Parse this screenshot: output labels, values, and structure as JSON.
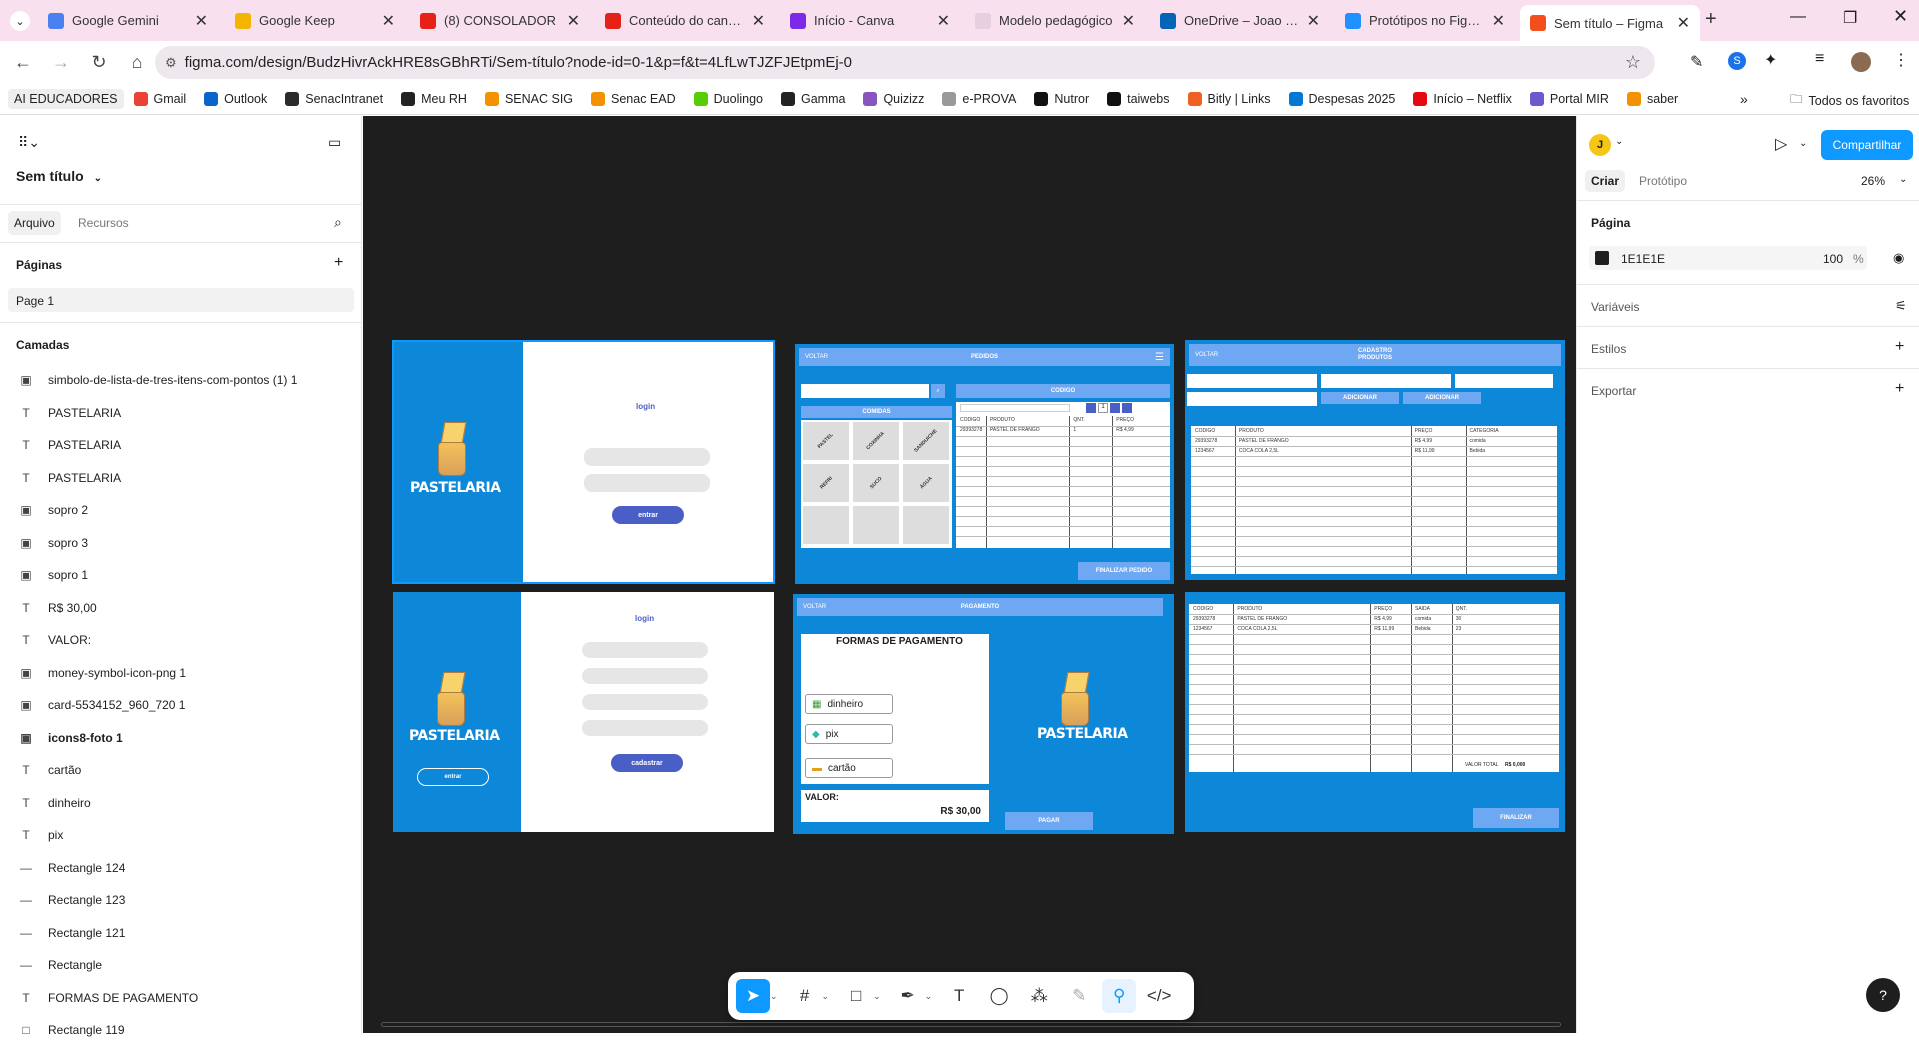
{
  "browser": {
    "tabs": [
      {
        "title": "Google Gemini",
        "color": "#4a80f0"
      },
      {
        "title": "Google Keep",
        "color": "#f5b400"
      },
      {
        "title": "(8) CONSOLADOR",
        "color": "#e62117"
      },
      {
        "title": "Conteúdo do canal -",
        "color": "#e62117"
      },
      {
        "title": "Início - Canva",
        "color": "#7d2ae8"
      },
      {
        "title": "Modelo pedagógico",
        "color": "#e8cfe0"
      },
      {
        "title": "OneDrive – Joao Beji",
        "color": "#0364b8"
      },
      {
        "title": "Protótipos no Figma",
        "color": "#1e90ff"
      },
      {
        "title": "Sem título – Figma",
        "color": "#f24e1e"
      }
    ],
    "url": "figma.com/design/BudzHivrAckHRE8sGBhRTi/Sem-título?node-id=0-1&p=f&t=4LfLwTJZFJEtpmEj-0",
    "bookmarks": [
      {
        "label": "AI EDUCADORES",
        "color": "#eee"
      },
      {
        "label": "Gmail",
        "color": "#ea4335"
      },
      {
        "label": "Outlook",
        "color": "#0a64c9"
      },
      {
        "label": "SenacIntranet",
        "color": "#2b2b2b"
      },
      {
        "label": "Meu RH",
        "color": "#222"
      },
      {
        "label": "SENAC SIG",
        "color": "#f39200"
      },
      {
        "label": "Senac EAD",
        "color": "#f39200"
      },
      {
        "label": "Duolingo",
        "color": "#58cc02"
      },
      {
        "label": "Gamma",
        "color": "#222"
      },
      {
        "label": "Quizizz",
        "color": "#8854c0"
      },
      {
        "label": "e-PROVA",
        "color": "#999"
      },
      {
        "label": "Nutror",
        "color": "#111"
      },
      {
        "label": "taiwebs",
        "color": "#111"
      },
      {
        "label": "Bitly | Links",
        "color": "#ee6123"
      },
      {
        "label": "Despesas 2025",
        "color": "#0078d4"
      },
      {
        "label": "Início – Netflix",
        "color": "#e50914"
      },
      {
        "label": "Portal MIR",
        "color": "#6a5acd"
      },
      {
        "label": "saber",
        "color": "#f39200"
      }
    ],
    "all_favorites": "Todos os favoritos"
  },
  "left": {
    "file_title": "Sem título",
    "tab_file": "Arquivo",
    "tab_assets": "Recursos",
    "pages_label": "Páginas",
    "page1": "Page 1",
    "layers_label": "Camadas",
    "layers": [
      {
        "icon": "image",
        "name": "simbolo-de-lista-de-tres-itens-com-pontos (1) 1"
      },
      {
        "icon": "text",
        "name": "PASTELARIA"
      },
      {
        "icon": "text",
        "name": "PASTELARIA"
      },
      {
        "icon": "text",
        "name": "PASTELARIA"
      },
      {
        "icon": "image",
        "name": "sopro 2"
      },
      {
        "icon": "image",
        "name": "sopro 3"
      },
      {
        "icon": "image",
        "name": "sopro 1"
      },
      {
        "icon": "text",
        "name": "R$ 30,00"
      },
      {
        "icon": "text",
        "name": "VALOR:"
      },
      {
        "icon": "image",
        "name": "money-symbol-icon-png 1"
      },
      {
        "icon": "image",
        "name": "card-5534152_960_720 1"
      },
      {
        "icon": "image",
        "name": "icons8-foto 1"
      },
      {
        "icon": "text",
        "name": "cartão"
      },
      {
        "icon": "text",
        "name": "dinheiro"
      },
      {
        "icon": "text",
        "name": "pix"
      },
      {
        "icon": "line",
        "name": "Rectangle 124"
      },
      {
        "icon": "line",
        "name": "Rectangle 123"
      },
      {
        "icon": "line",
        "name": "Rectangle 121"
      },
      {
        "icon": "line",
        "name": "Rectangle"
      },
      {
        "icon": "text",
        "name": "FORMAS DE PAGAMENTO"
      },
      {
        "icon": "rect",
        "name": "Rectangle 119"
      }
    ]
  },
  "right": {
    "avatar": "J",
    "share": "Compartilhar",
    "tab_design": "Criar",
    "tab_proto": "Protótipo",
    "zoom": "26%",
    "page_label": "Página",
    "bg_hex": "1E1E1E",
    "bg_opacity": "100",
    "percent": "%",
    "variables": "Variáveis",
    "styles": "Estilos",
    "export": "Exportar",
    "help": "?"
  },
  "canvas": {
    "logo": "PASTELARIA",
    "login_title": "login",
    "login_btn": "entrar",
    "register_btn": "cadastrar",
    "entrar2": "entrar",
    "voltar": "VOLTAR",
    "pedidos_title": "PEDIDOS",
    "codigo_btn": "CODIGO",
    "comidas": "COMIDAS",
    "menu_items": [
      "PASTEL",
      "COXINHA",
      "SANDUICHE",
      "REFRI",
      "SUCO",
      "ÁGUA"
    ],
    "order_headers": [
      "CODIGO",
      "PRODUTO",
      "QNT.",
      "PREÇO"
    ],
    "order_row": [
      "29393278",
      "PASTEL DE FRANGO",
      "1",
      "R$ 4,99"
    ],
    "finalizar_pedido": "FINALIZAR PEDIDO",
    "cadastro_title": "CADASTRO PRODUTOS",
    "adicionar": "ADICIONAR",
    "prod_headers": [
      "CODIGO",
      "PRODUTO",
      "PREÇO",
      "CATEGORIA"
    ],
    "prod_rows": [
      [
        "29393278",
        "PASTEL DE FRANGO",
        "R$ 4,99",
        "comida"
      ],
      [
        "1234567",
        "COCA COLA 2,5L",
        "R$ 11,99",
        "Bebida"
      ]
    ],
    "pagamento_title": "PAGAMENTO",
    "formas": "FORMAS DE PAGAMENTO",
    "dinheiro": "dinheiro",
    "pix": "pix",
    "cartao": "cartão",
    "valor": "VALOR:",
    "valor_amt": "R$ 30,00",
    "pagar": "PAGAR",
    "stock_headers": [
      "CODIGO",
      "PRODUTO",
      "PREÇO",
      "SAIDA",
      "QNT."
    ],
    "stock_rows": [
      [
        "29393278",
        "PASTEL DE FRANGO",
        "R$ 4,99",
        "comida",
        "30"
      ],
      [
        "1234567",
        "COCA COLA 2,5L",
        "R$ 11,99",
        "Bebida",
        "23"
      ]
    ],
    "valor_total": "VALOR TOTAL",
    "valor_total_amt": "R$ 0,000",
    "finalizar": "FINALIZAR"
  }
}
